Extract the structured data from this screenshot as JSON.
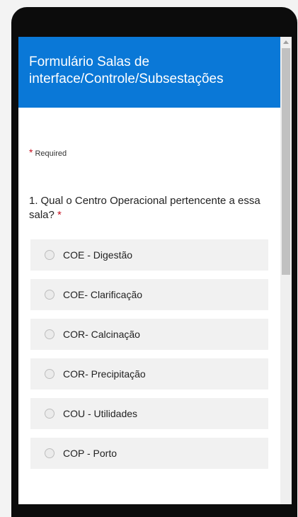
{
  "form": {
    "title": "Formulário Salas de interface/Controle/Subsestações",
    "required_star": "*",
    "required_label": "Required"
  },
  "question": {
    "number": "1.",
    "text": "Qual o Centro Operacional pertencente a essa sala?",
    "required_star": "*",
    "options": [
      {
        "label": "COE - Digestão",
        "selected": false
      },
      {
        "label": "COE- Clarificação",
        "selected": false
      },
      {
        "label": "COR- Calcinação",
        "selected": false
      },
      {
        "label": "COR- Precipitação",
        "selected": false
      },
      {
        "label": "COU - Utilidades",
        "selected": false
      },
      {
        "label": "COP - Porto",
        "selected": false
      }
    ]
  },
  "colors": {
    "header_bg": "#0a78d7",
    "required_star": "#c50f1f",
    "option_bg": "#f1f1f1"
  }
}
